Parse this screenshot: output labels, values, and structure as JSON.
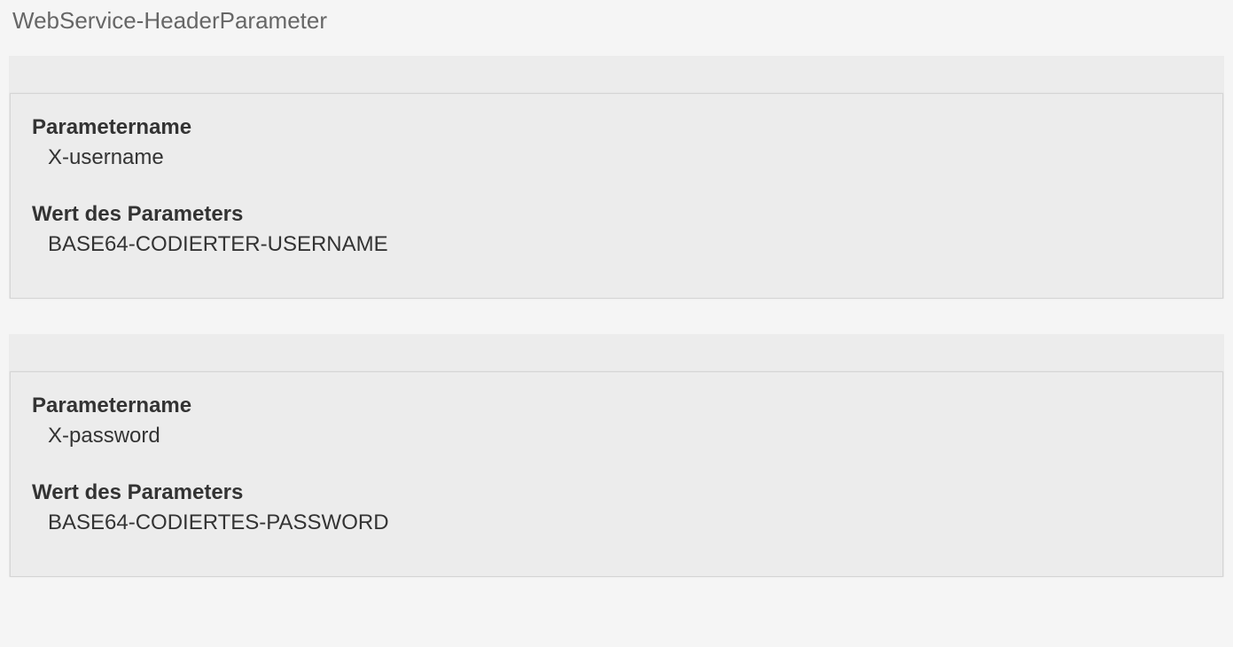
{
  "page": {
    "title": "WebService-HeaderParameter"
  },
  "labels": {
    "parameter_name": "Parametername",
    "parameter_value": "Wert des Parameters"
  },
  "parameters": [
    {
      "name": "X-username",
      "value": "BASE64-CODIERTER-USERNAME"
    },
    {
      "name": "X-password",
      "value": "BASE64-CODIERTES-PASSWORD"
    }
  ]
}
